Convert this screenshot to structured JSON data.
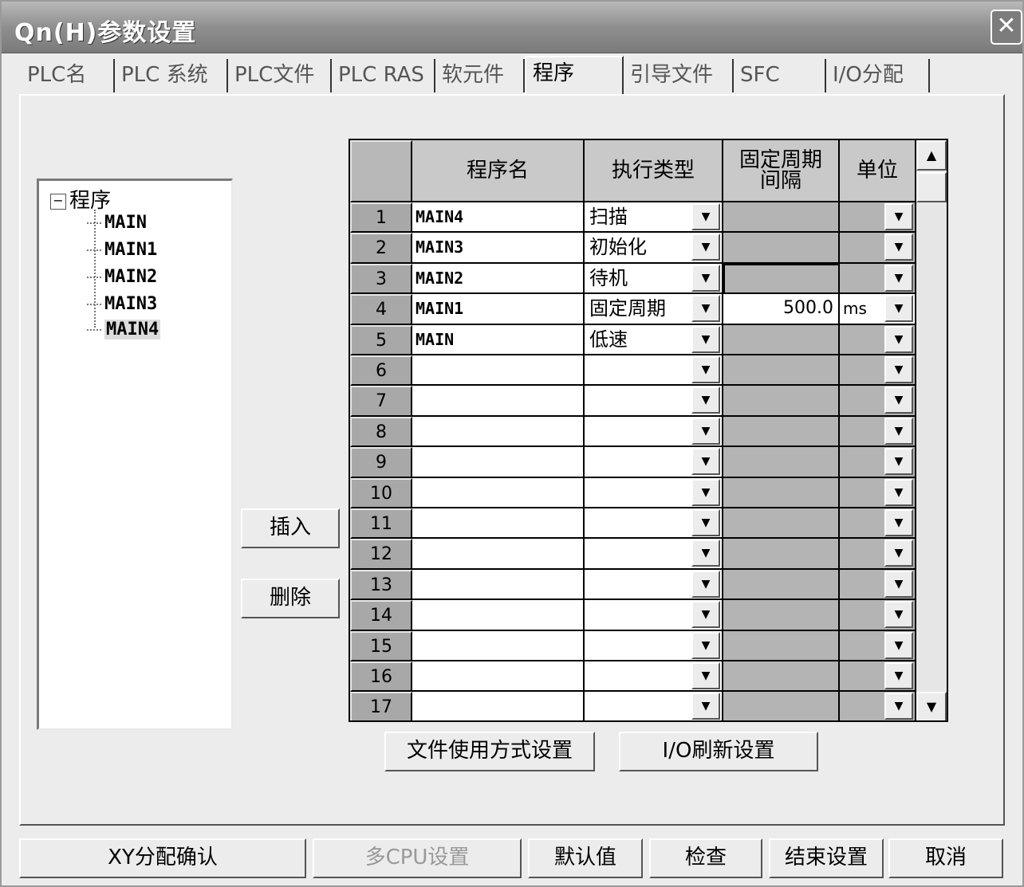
{
  "window": {
    "title": "Qn(H)参数设置",
    "close_glyph": "✕"
  },
  "tabs": [
    {
      "label": "PLC名"
    },
    {
      "label": "PLC 系统"
    },
    {
      "label": "PLC文件"
    },
    {
      "label": "PLC RAS"
    },
    {
      "label": "软元件"
    },
    {
      "label": "程序"
    },
    {
      "label": "引导文件"
    },
    {
      "label": "SFC"
    },
    {
      "label": "I/O分配"
    }
  ],
  "tree": {
    "expander": "−",
    "root": "程序",
    "items": [
      "MAIN",
      "MAIN1",
      "MAIN2",
      "MAIN3",
      "MAIN4"
    ]
  },
  "buttons": {
    "insert": "插入",
    "delete": "删除",
    "file_usage": "文件使用方式设置",
    "io_refresh": "I/O刷新设置"
  },
  "grid": {
    "headers": {
      "name": "程序名",
      "type": "执行类型",
      "interval": "固定周期间隔",
      "unit": "单位"
    },
    "rows": [
      {
        "no": "1",
        "name": "MAIN4",
        "type": "扫描",
        "interval": "",
        "unit": ""
      },
      {
        "no": "2",
        "name": "MAIN3",
        "type": "初始化",
        "interval": "",
        "unit": ""
      },
      {
        "no": "3",
        "name": "MAIN2",
        "type": "待机",
        "interval": "",
        "unit": ""
      },
      {
        "no": "4",
        "name": "MAIN1",
        "type": "固定周期",
        "interval": "500.0",
        "unit": "ms"
      },
      {
        "no": "5",
        "name": "MAIN",
        "type": "低速",
        "interval": "",
        "unit": ""
      },
      {
        "no": "6",
        "name": "",
        "type": "",
        "interval": "",
        "unit": ""
      },
      {
        "no": "7",
        "name": "",
        "type": "",
        "interval": "",
        "unit": ""
      },
      {
        "no": "8",
        "name": "",
        "type": "",
        "interval": "",
        "unit": ""
      },
      {
        "no": "9",
        "name": "",
        "type": "",
        "interval": "",
        "unit": ""
      },
      {
        "no": "10",
        "name": "",
        "type": "",
        "interval": "",
        "unit": ""
      },
      {
        "no": "11",
        "name": "",
        "type": "",
        "interval": "",
        "unit": ""
      },
      {
        "no": "12",
        "name": "",
        "type": "",
        "interval": "",
        "unit": ""
      },
      {
        "no": "13",
        "name": "",
        "type": "",
        "interval": "",
        "unit": ""
      },
      {
        "no": "14",
        "name": "",
        "type": "",
        "interval": "",
        "unit": ""
      },
      {
        "no": "15",
        "name": "",
        "type": "",
        "interval": "",
        "unit": ""
      },
      {
        "no": "16",
        "name": "",
        "type": "",
        "interval": "",
        "unit": ""
      },
      {
        "no": "17",
        "name": "",
        "type": "",
        "interval": "",
        "unit": ""
      }
    ],
    "dropdown_glyph": "▼",
    "scroll_up_glyph": "▲",
    "scroll_down_glyph": "▼"
  },
  "footer": {
    "xy_confirm": "XY分配确认",
    "multi_cpu": "多CPU设置",
    "default": "默认值",
    "check": "检查",
    "finish": "结束设置",
    "cancel": "取消"
  }
}
